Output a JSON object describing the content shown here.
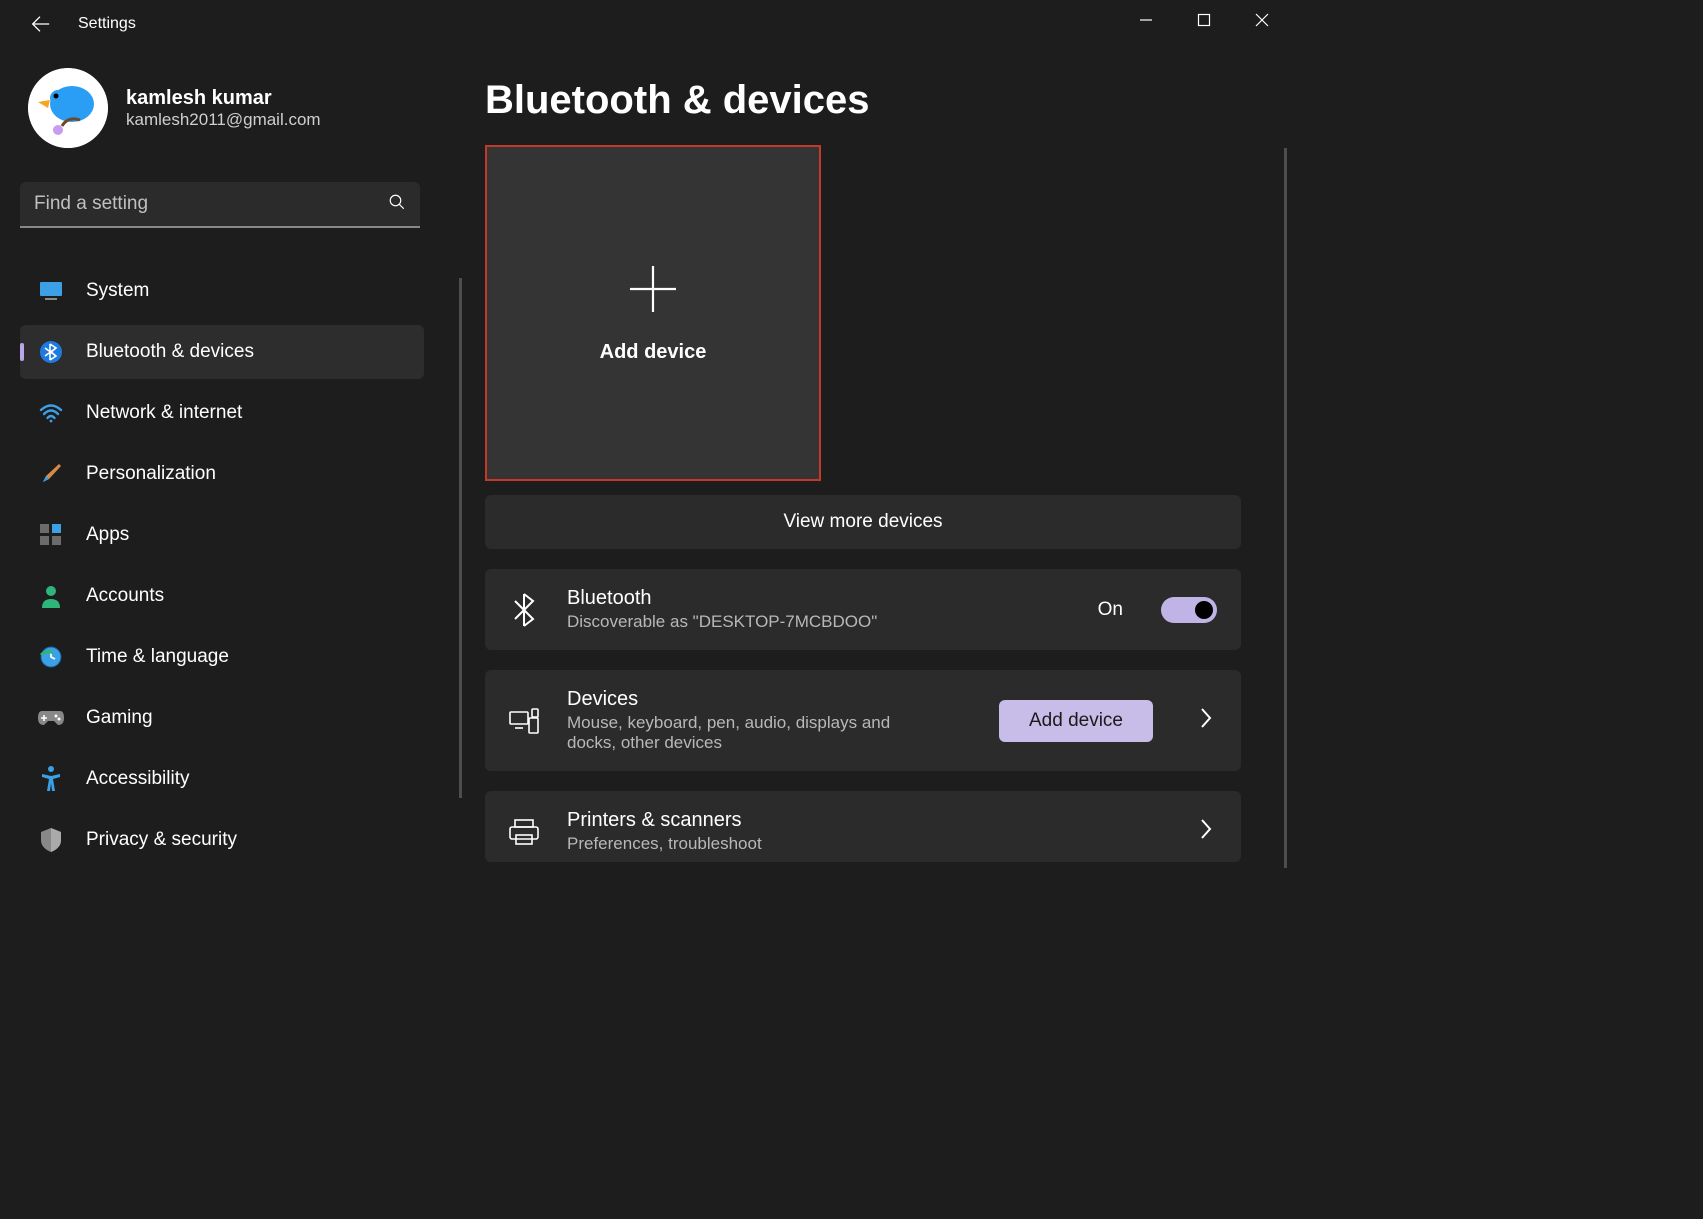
{
  "app": {
    "title": "Settings"
  },
  "profile": {
    "name": "kamlesh kumar",
    "email": "kamlesh2011@gmail.com"
  },
  "search": {
    "placeholder": "Find a setting"
  },
  "nav": [
    {
      "label": "System",
      "icon": "monitor"
    },
    {
      "label": "Bluetooth & devices",
      "icon": "bluetooth-blue",
      "active": true
    },
    {
      "label": "Network & internet",
      "icon": "wifi"
    },
    {
      "label": "Personalization",
      "icon": "brush"
    },
    {
      "label": "Apps",
      "icon": "apps"
    },
    {
      "label": "Accounts",
      "icon": "person"
    },
    {
      "label": "Time & language",
      "icon": "clock"
    },
    {
      "label": "Gaming",
      "icon": "gamepad"
    },
    {
      "label": "Accessibility",
      "icon": "a11y"
    },
    {
      "label": "Privacy & security",
      "icon": "shield"
    }
  ],
  "page": {
    "title": "Bluetooth & devices",
    "add_device_tile": "Add device",
    "view_more": "View more devices"
  },
  "bluetooth_card": {
    "title": "Bluetooth",
    "subtitle": "Discoverable as \"DESKTOP-7MCBDOO\"",
    "toggle_state_label": "On",
    "toggle_on": true
  },
  "devices_card": {
    "title": "Devices",
    "subtitle": "Mouse, keyboard, pen, audio, displays and docks, other devices",
    "button": "Add device"
  },
  "printers_card": {
    "title": "Printers & scanners",
    "subtitle": "Preferences, troubleshoot"
  }
}
